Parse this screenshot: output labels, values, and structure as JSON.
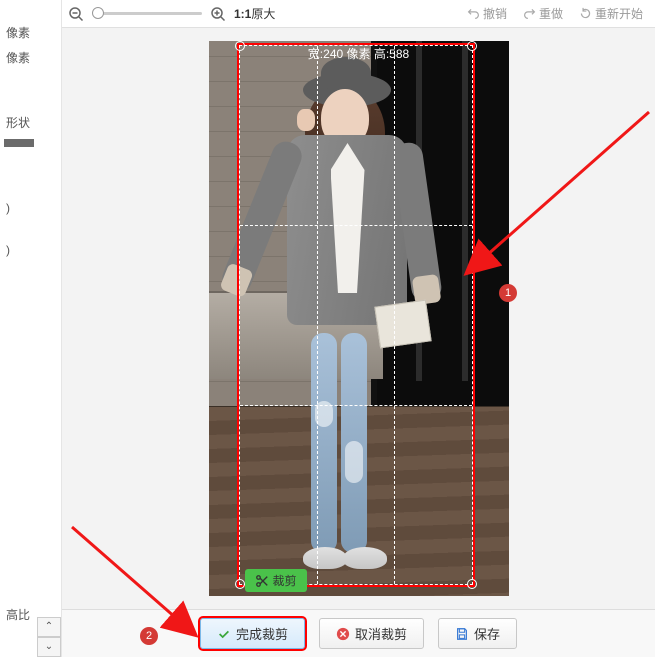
{
  "left": {
    "pixel_label": "像素",
    "shape_label": "形状",
    "paren": ")",
    "ratio_label": "高比"
  },
  "toolbar": {
    "ratio": "1:1",
    "original": "原大",
    "undo": "撤销",
    "redo": "重做",
    "restart": "重新开始"
  },
  "crop": {
    "top_label": "宽:240 像素 高:588",
    "badge": "裁剪"
  },
  "buttons": {
    "finish": "完成裁剪",
    "cancel": "取消裁剪",
    "save": "保存"
  },
  "anno": {
    "n1": "1",
    "n2": "2"
  }
}
